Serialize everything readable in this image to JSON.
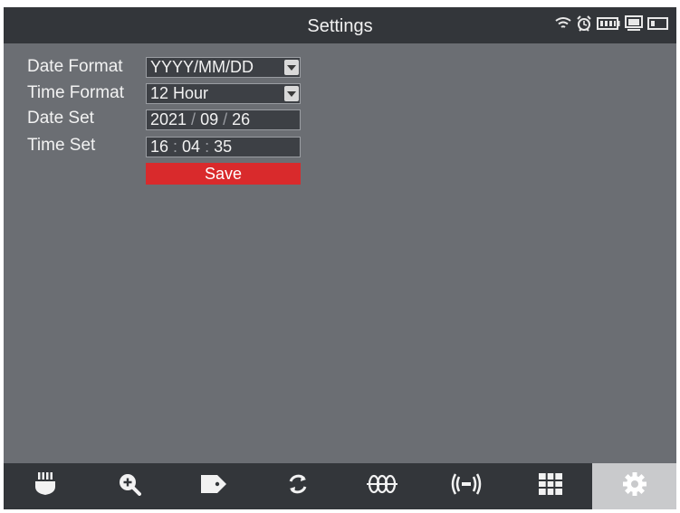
{
  "header": {
    "title": "Settings"
  },
  "status_icons": [
    "wifi-icon",
    "alarm-icon",
    "battery-icon",
    "monitor-icon",
    "device-battery-icon"
  ],
  "settings": {
    "date_format": {
      "label": "Date Format",
      "value": "YYYY/MM/DD"
    },
    "time_format": {
      "label": "Time Format",
      "value": "12 Hour"
    },
    "date_set": {
      "label": "Date Set",
      "year": "2021",
      "month": "09",
      "day": "26",
      "separator": "/"
    },
    "time_set": {
      "label": "Time Set",
      "hour": "16",
      "minute": "04",
      "second": "35",
      "separator": ":"
    },
    "save_label": "Save"
  },
  "toolbar": {
    "items": [
      {
        "icon": "probe-icon"
      },
      {
        "icon": "zoom-in-icon"
      },
      {
        "icon": "tag-icon"
      },
      {
        "icon": "refresh-icon"
      },
      {
        "icon": "waveform-icon"
      },
      {
        "icon": "signal-icon"
      },
      {
        "icon": "grid-icon"
      },
      {
        "icon": "settings-gear-icon",
        "active": true
      }
    ]
  },
  "colors": {
    "screen_bg": "#6b6e73",
    "bar_bg": "#33363a",
    "save_button": "#d92a2c",
    "active_tab": "#c9cacc"
  }
}
